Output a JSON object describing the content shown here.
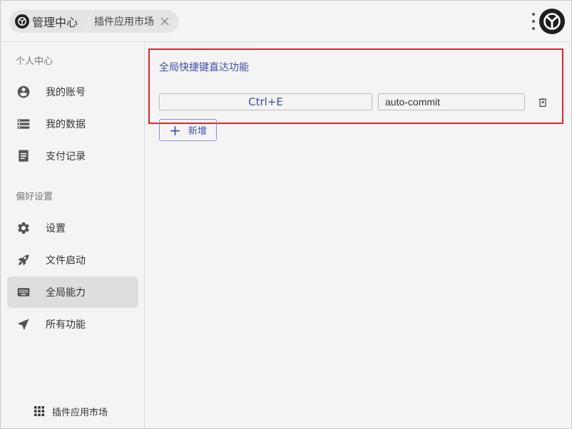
{
  "titlebar": {
    "home_label": "管理中心",
    "tab_label": "插件应用市场",
    "close_symbol": "✕"
  },
  "sidebar": {
    "section_personal": "个人中心",
    "section_prefs": "偏好设置",
    "items": [
      {
        "label": "我的账号",
        "icon": "account-circle-icon"
      },
      {
        "label": "我的数据",
        "icon": "storage-list-icon"
      },
      {
        "label": "支付记录",
        "icon": "receipt-icon"
      },
      {
        "label": "设置",
        "icon": "gear-icon"
      },
      {
        "label": "文件启动",
        "icon": "rocket-icon"
      },
      {
        "label": "全局能力",
        "icon": "keyboard-icon",
        "active": true
      },
      {
        "label": "所有功能",
        "icon": "navigation-arrow-icon"
      }
    ],
    "market_label": "插件应用市场"
  },
  "main": {
    "feature_title": "全局快捷键直达功能",
    "rows": [
      {
        "hotkey": "Ctrl+E",
        "command": "auto-commit"
      }
    ],
    "add_label": "新增",
    "add_symbol": "+"
  },
  "colors": {
    "accent": "#3f4fa8",
    "highlight_border": "#d9262e",
    "background": "#f4f4f4",
    "active_item": "#dedede"
  }
}
